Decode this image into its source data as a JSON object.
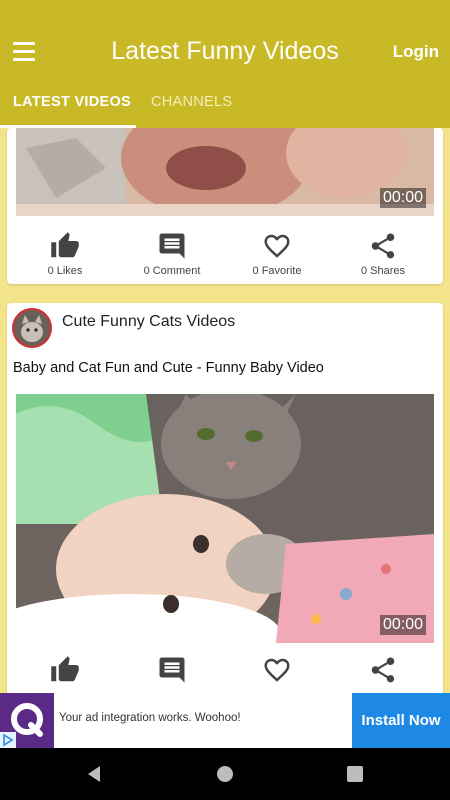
{
  "appbar": {
    "title": "Latest Funny Videos",
    "login_label": "Login"
  },
  "tabs": [
    {
      "label": "LATEST VIDEOS",
      "active": true
    },
    {
      "label": "CHANNELS",
      "active": false
    }
  ],
  "cards": [
    {
      "duration": "00:00",
      "actions": {
        "likes": "0 Likes",
        "comments": "0 Comment",
        "favorites": "0 Favorite",
        "shares": "0 Shares"
      }
    },
    {
      "channel_name": "Cute Funny Cats Videos",
      "video_title": "Baby and Cat Fun and Cute - Funny Baby Video",
      "duration": "00:00"
    }
  ],
  "ad": {
    "text": "Your ad integration works. Woohoo!",
    "button_label": "Install Now"
  },
  "colors": {
    "appbar": "#c9b927",
    "background": "#f3e48a",
    "ad_button": "#1e88e5"
  }
}
